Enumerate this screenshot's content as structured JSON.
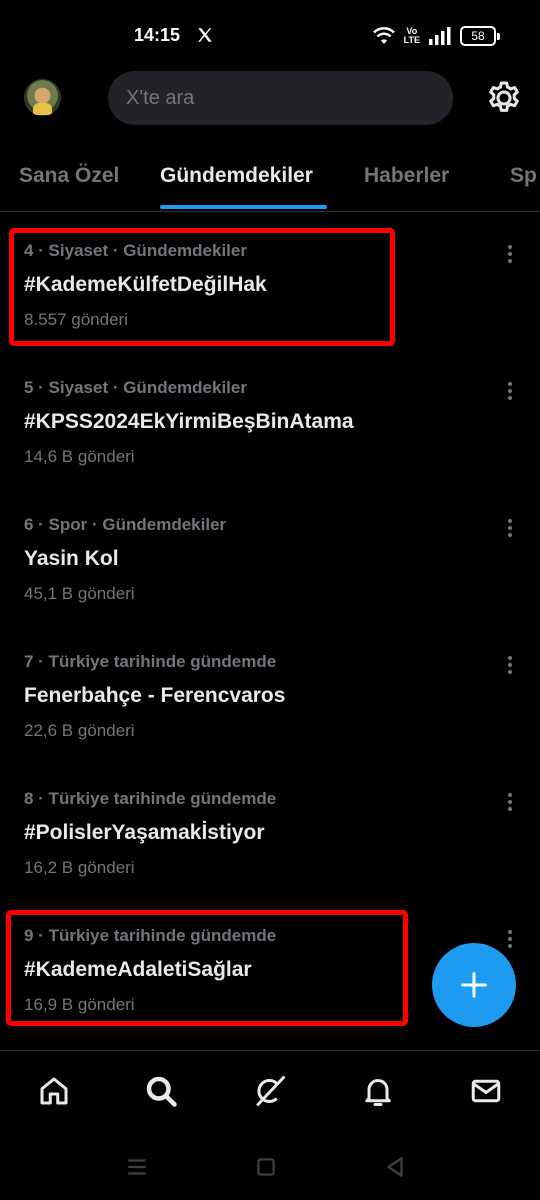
{
  "status_bar": {
    "time": "14:15",
    "volte_top": "Vo",
    "volte_bottom": "LTE",
    "battery": "58"
  },
  "header": {
    "search_placeholder": "X'te ara",
    "settings_icon": "gear-icon"
  },
  "tabs": [
    {
      "label": "Sana Özel",
      "active": false
    },
    {
      "label": "Gündemdekiler",
      "active": true
    },
    {
      "label": "Haberler",
      "active": false
    },
    {
      "label": "Sp",
      "active": false
    }
  ],
  "trends": [
    {
      "meta": "4 · Siyaset · Gündemdekiler",
      "title": "#KademeKülfetDeğilHak",
      "count": "8.557 gönderi",
      "highlighted": true
    },
    {
      "meta": "5 · Siyaset · Gündemdekiler",
      "title": "#KPSS2024EkYirmiBeşBinAtama",
      "count": "14,6 B gönderi",
      "highlighted": false
    },
    {
      "meta": "6 · Spor · Gündemdekiler",
      "title": "Yasin Kol",
      "count": "45,1 B gönderi",
      "highlighted": false
    },
    {
      "meta": "7 · Türkiye tarihinde gündemde",
      "title": "Fenerbahçe - Ferencvaros",
      "count": "22,6 B gönderi",
      "highlighted": false
    },
    {
      "meta": "8 · Türkiye tarihinde gündemde",
      "title": "#PolislerYaşamakİstiyor",
      "count": "16,2 B gönderi",
      "highlighted": false
    },
    {
      "meta": "9 · Türkiye tarihinde gündemde",
      "title": "#KademeAdaletiSağlar",
      "count": "16,9 B gönderi",
      "highlighted": true
    }
  ],
  "fab_icon": "plus-icon",
  "bottom_nav": [
    "home-icon",
    "search-icon",
    "grok-icon",
    "bell-icon",
    "mail-icon"
  ],
  "colors": {
    "accent": "#1d9bf0",
    "highlight": "#ff0000",
    "muted_text": "#71767b",
    "background": "#000000"
  }
}
